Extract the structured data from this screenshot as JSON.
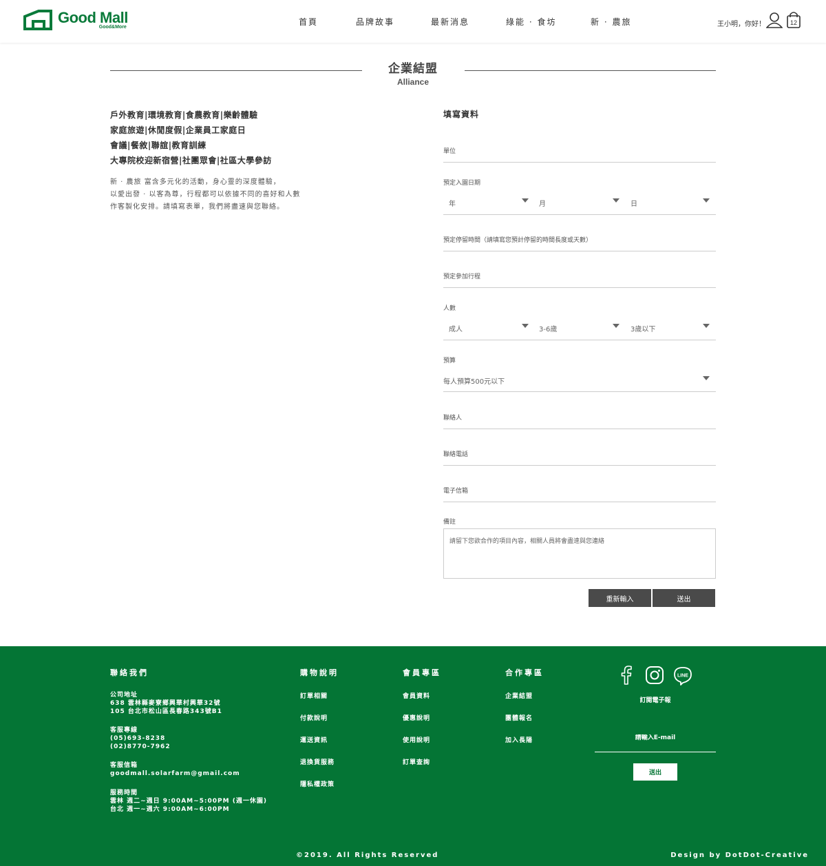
{
  "header": {
    "logo_main": "Good Mall",
    "logo_sub": "Good&More",
    "nav": [
      "首頁",
      "品牌故事",
      "最新消息",
      "綠能 · 食坊",
      "新 · 農旅"
    ],
    "greeting": "王小明，你好！",
    "cart_count": "12"
  },
  "title": {
    "main": "企業結盟",
    "sub": "Alliance"
  },
  "left": {
    "headings": [
      "戶外教育|環境教育|食農教育|樂齡體驗",
      "家庭旅遊|休閒度假|企業員工家庭日",
      "會議|餐敘|聯誼|教育訓練",
      "大專院校迎新宿營|社團眾會|社區大學參訪"
    ],
    "intro": [
      "新 · 農旅 富含多元化的活動，身心靈的深度體驗，",
      "以愛出發 · 以客為尊，行程都可以依據不同的喜好和人數",
      "作客製化安排。請填寫表單，我們將盡速與您聯絡。"
    ]
  },
  "form": {
    "title": "填寫資料",
    "unit_label": "單位",
    "date_label": "預定入園日期",
    "year": "年",
    "month": "月",
    "day": "日",
    "stay_label": "預定停留時間（請填寫您預計停留的時間長度或天數）",
    "itinerary_label": "預定參加行程",
    "people_label": "人數",
    "adult": "成人",
    "child": "3-6歲",
    "infant": "3歲以下",
    "budget_label": "預算",
    "budget_value": "每人預算500元以下",
    "contact_label": "聯絡人",
    "phone_label": "聯絡電話",
    "email_label": "電子信箱",
    "note_label": "備註",
    "note_placeholder": "請留下您欲合作的項目內容，相關人員將會盡速與您連絡",
    "reset": "重新輸入",
    "submit": "送出"
  },
  "footer": {
    "contact_title": "聯絡我們",
    "address_title": "公司地址",
    "address_1": "638 雲林縣麥寮鄉興華村興華32號",
    "address_2": "105 台北市松山區長春路343號B1",
    "hotline_title": "客服專線",
    "phone_1": "(05)693-8238",
    "phone_2": "(02)8770-7962",
    "mail_title": "客服信箱",
    "mail": "goodmall.solarfarm@gmail.com",
    "hours_title": "服務時間",
    "hours_1": "雲林 週二~週日 9:00AM~5:00PM (週一休園)",
    "hours_2": "台北 週一~週六 9:00AM~6:00PM",
    "shopping_title": "購物說明",
    "shopping_links": [
      "訂單相關",
      "付款說明",
      "運送資訊",
      "退換貨服務",
      "隱私權政策"
    ],
    "member_title": "會員專區",
    "member_links": [
      "會員資料",
      "優惠說明",
      "使用說明",
      "訂單查詢"
    ],
    "partner_title": "合作專區",
    "partner_links": [
      "企業結盟",
      "團體報名",
      "加入長陽"
    ],
    "subscribe_title": "訂閱電子報",
    "email_placeholder": "請輸入E-mail",
    "send": "送出",
    "copyright": "©2019. All Rights Reserved",
    "design": "Design by DotDot-Creative"
  },
  "colors": {
    "brand_green": "#047535",
    "button_gray": "#4a4a4a"
  }
}
